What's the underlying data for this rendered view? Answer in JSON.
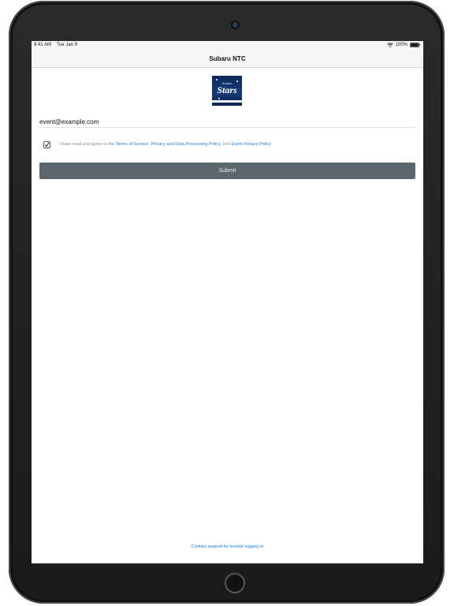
{
  "status_bar": {
    "time": "9:41 AM",
    "date": "Tue Jan 9",
    "battery": "100%"
  },
  "nav": {
    "title": "Subaru NTC"
  },
  "logo": {
    "small_text": "Subaru",
    "main_text": "Stars"
  },
  "login": {
    "email_value": "event@example.com",
    "agree_checked": true,
    "agree_prefix": "I have read and agree to the ",
    "terms_link": "Terms of Service",
    "separator": ", ",
    "privacy_link": "Privacy and Data Processing Policy",
    "and_text": ", and ",
    "event_privacy_link": "Event Privacy Policy",
    "submit_label": "Submit"
  },
  "footer": {
    "support_link": "Contact support for trouble logging in"
  },
  "colors": {
    "link": "#1f7ae0",
    "submit_bg": "#5b666d",
    "logo_bg": "#153a78"
  },
  "icons": {
    "wifi": "wifi-icon",
    "battery": "battery-icon",
    "checkbox": "checkmark-icon"
  }
}
